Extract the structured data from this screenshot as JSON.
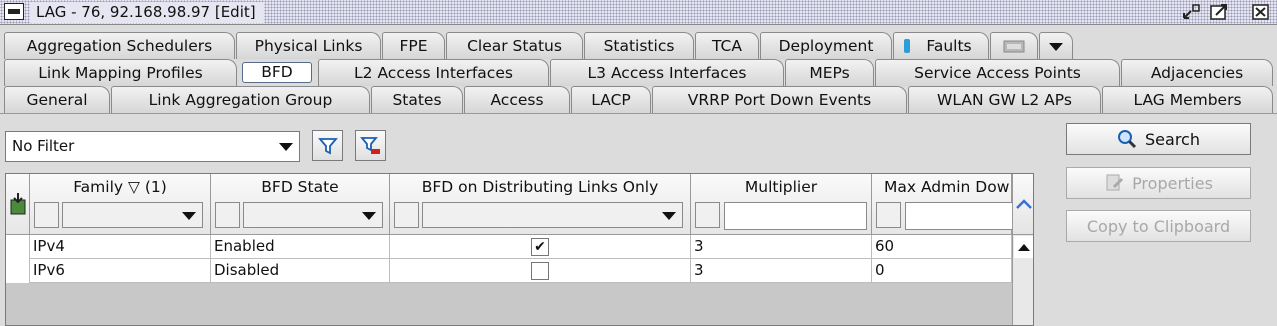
{
  "window": {
    "title": "LAG - 76, 92.168.98.97 [Edit]"
  },
  "tabs": {
    "row1": [
      {
        "label": "Aggregation Schedulers"
      },
      {
        "label": "Physical Links"
      },
      {
        "label": "FPE"
      },
      {
        "label": "Clear Status"
      },
      {
        "label": "Statistics"
      },
      {
        "label": "TCA"
      },
      {
        "label": "Deployment"
      },
      {
        "label": "Faults"
      }
    ],
    "row2": [
      {
        "label": "Link Mapping Profiles"
      },
      {
        "label": "BFD",
        "active": true
      },
      {
        "label": "L2 Access Interfaces"
      },
      {
        "label": "L3 Access Interfaces"
      },
      {
        "label": "MEPs"
      },
      {
        "label": "Service Access Points"
      },
      {
        "label": "Adjacencies"
      }
    ],
    "row3": [
      {
        "label": "General"
      },
      {
        "label": "Link Aggregation Group"
      },
      {
        "label": "States"
      },
      {
        "label": "Access"
      },
      {
        "label": "LACP"
      },
      {
        "label": "VRRP Port Down Events"
      },
      {
        "label": "WLAN GW L2 APs"
      },
      {
        "label": "LAG Members"
      }
    ]
  },
  "filter": {
    "value": "No Filter"
  },
  "side_buttons": {
    "search": "Search",
    "properties": "Properties",
    "copy": "Copy to Clipboard"
  },
  "table": {
    "columns": [
      {
        "label": "Family ▽ (1)"
      },
      {
        "label": "BFD State"
      },
      {
        "label": "BFD on Distributing Links Only"
      },
      {
        "label": "Multiplier"
      },
      {
        "label": "Max Admin Dow"
      }
    ],
    "rows": [
      {
        "family": "IPv4",
        "bfd_state": "Enabled",
        "distributing_only": true,
        "multiplier": "3",
        "max_admin_down": "60"
      },
      {
        "family": "IPv6",
        "bfd_state": "Disabled",
        "distributing_only": false,
        "multiplier": "3",
        "max_admin_down": "0"
      }
    ]
  },
  "colors": {
    "accent": "#1a5fb4",
    "tab_active_border": "#5a6a8a",
    "faults_icon": "#2a9fd6"
  }
}
